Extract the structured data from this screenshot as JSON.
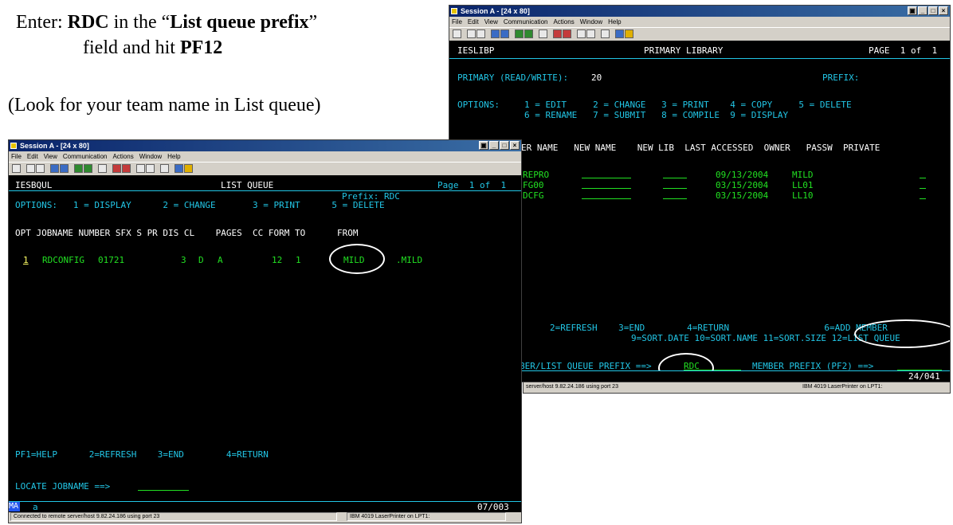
{
  "instructions": {
    "line1_pre": "Enter: ",
    "line1_rdc": "RDC",
    "line1_mid": " in the “",
    "line1_field": "List queue prefix",
    "line1_end": "”",
    "line2_pre": "field and hit ",
    "line2_key": "PF12",
    "line3": "(Look for your team name in List queue)"
  },
  "menu": [
    "File",
    "Edit",
    "View",
    "Communication",
    "Actions",
    "Window",
    "Help"
  ],
  "winbtns": {
    "restore": "▣",
    "min": "_",
    "max": "□",
    "close": "×"
  },
  "back_window": {
    "title": "Session A - [24 x 80]",
    "header": {
      "id": "IESLIBP",
      "title": "PRIMARY LIBRARY",
      "page": "PAGE  1 of  1"
    },
    "primary_label": "PRIMARY (READ/WRITE):",
    "primary_value": "20",
    "prefix_label": "PREFIX:",
    "options_label": "OPTIONS:",
    "options_row1": "1 = EDIT     2 = CHANGE   3 = PRINT    4 = COPY     5 = DELETE",
    "options_row2": "6 = RENAME   7 = SUBMIT   8 = COMPILE  9 = DISPLAY",
    "columns": "ER NAME   NEW NAME    NEW LIB  LAST ACCESSED  OWNER   PASSW  PRIVATE",
    "rows": [
      {
        "name": "REPRO",
        "date": "09/13/2004",
        "owner": "MILD"
      },
      {
        "name": "FG00",
        "date": "03/15/2004",
        "owner": "LL01"
      },
      {
        "name": "DCFG",
        "date": "03/15/2004",
        "owner": "LL10"
      }
    ],
    "pf_row1": "2=REFRESH    3=END        4=RETURN                  6=ADD MEMBER",
    "pf_row2": "9=SORT.DATE 10=SORT.NAME 11=SORT.SIZE 12=LIST QUEUE",
    "prompt_label": "BER/LIST QUEUE PREFIX ==>",
    "prompt_value": "RDC_",
    "member_prefix_label": "MEMBER PREFIX (PF2) ==>",
    "cursor_pos": "24/041",
    "status_conn": "server/host 9.82.24.186 using port 23",
    "status_printer": "IBM 4019 LaserPrinter on LPT1:"
  },
  "front_window": {
    "title": "Session A - [24 x 80]",
    "header": {
      "id": "IESBQUL",
      "title": "LIST QUEUE",
      "page": "Page  1 of  1"
    },
    "prefix": "Prefix: RDC",
    "options": "OPTIONS:   1 = DISPLAY      2 = CHANGE       3 = PRINT      5 = DELETE",
    "columns": "OPT JOBNAME NUMBER SFX S PR DIS CL    PAGES  CC FORM TO      FROM",
    "row": {
      "opt": "1",
      "jobname": "RDCONFIG",
      "number": "01721",
      "pr": "3",
      "dis": "D",
      "cl": "A",
      "pages": "12",
      "cc": "1",
      "to": "MILD",
      "from": ".MILD"
    },
    "pf_keys": "PF1=HELP      2=REFRESH    3=END        4=RETURN",
    "locate_label": "LOCATE JOBNAME ==>",
    "oia_mode": "MA",
    "oia_a": "a",
    "cursor_pos": "07/003",
    "status_conn": "Connected to remote server/host 9.82.24.186 using port 23",
    "status_printer": "IBM 4019 LaserPrinter on LPT1:"
  }
}
